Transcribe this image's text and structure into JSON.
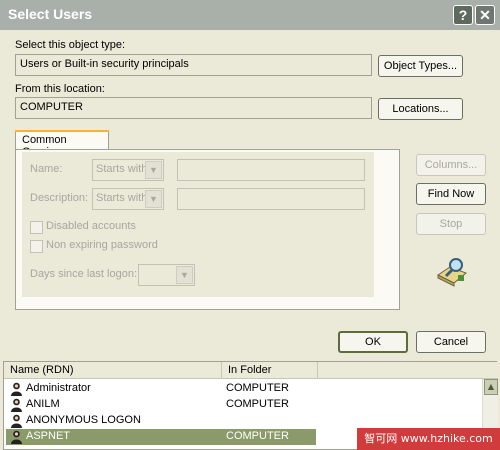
{
  "window": {
    "title": "Select Users",
    "help_glyph": "?",
    "close_glyph": "✕"
  },
  "object_type": {
    "label": "Select this object type:",
    "value": "Users or Built-in security principals",
    "button": "Object Types..."
  },
  "location": {
    "label": "From this location:",
    "value": "COMPUTER",
    "button": "Locations..."
  },
  "common_queries": {
    "tab_label": "Common Queries",
    "name_label": "Name:",
    "name_operator": "Starts with",
    "description_label": "Description:",
    "description_operator": "Starts with",
    "disabled_accounts": "Disabled accounts",
    "non_expiring_password": "Non expiring password",
    "days_since_logon_label": "Days since last logon:"
  },
  "side_buttons": {
    "columns": "Columns...",
    "find_now": "Find Now",
    "stop": "Stop"
  },
  "footer": {
    "ok": "OK",
    "cancel": "Cancel"
  },
  "results": {
    "columns": [
      "Name (RDN)",
      "In Folder"
    ],
    "rows": [
      {
        "name": "Administrator",
        "folder": "COMPUTER"
      },
      {
        "name": "ANILM",
        "folder": "COMPUTER"
      },
      {
        "name": "ANONYMOUS LOGON",
        "folder": ""
      },
      {
        "name": "ASPNET",
        "folder": "COMPUTER"
      }
    ],
    "selected_row": "ASPNET"
  },
  "watermark": "智可网 www.hzhike.com",
  "colors": {
    "titlebar": "#a9b0a9",
    "dialog_bg": "#ebe9d8",
    "selection": "#8a9a6b",
    "tab_accent": "#f4b23b"
  }
}
